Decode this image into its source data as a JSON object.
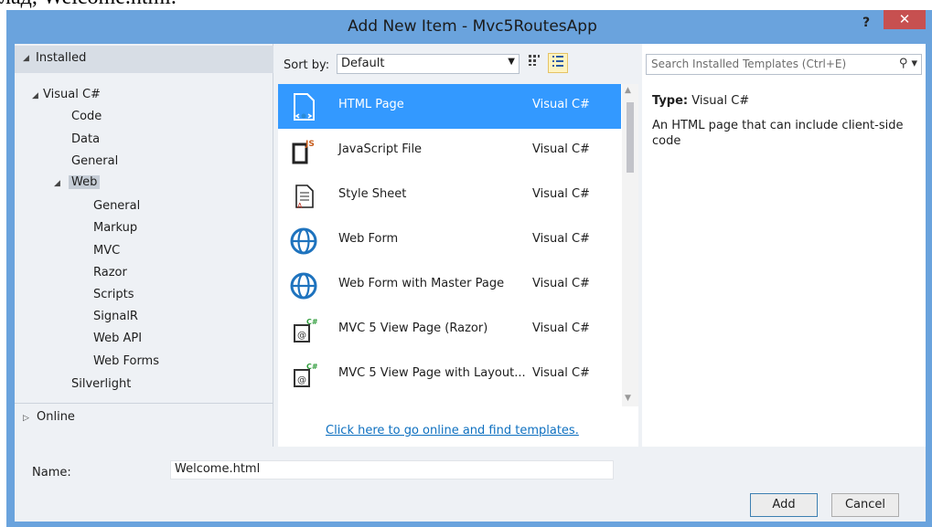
{
  "background_caption": "лад, Welcome.html.",
  "window": {
    "title": "Add New Item - Mvc5RoutesApp",
    "help": "?",
    "close": "✕"
  },
  "tree": {
    "installed": "Installed",
    "visual_csharp": "Visual C#",
    "code": "Code",
    "data": "Data",
    "general": "General",
    "web": "Web",
    "web_children": [
      "General",
      "Markup",
      "MVC",
      "Razor",
      "Scripts",
      "SignalR",
      "Web API",
      "Web Forms"
    ],
    "silverlight": "Silverlight",
    "online": "Online"
  },
  "sortbar": {
    "label": "Sort by:",
    "value": "Default"
  },
  "items": [
    {
      "name": "HTML Page",
      "type": "Visual C#",
      "icon": "html-page-icon",
      "selected": true
    },
    {
      "name": "JavaScript File",
      "type": "Visual C#",
      "icon": "javascript-file-icon",
      "selected": false
    },
    {
      "name": "Style Sheet",
      "type": "Visual C#",
      "icon": "style-sheet-icon",
      "selected": false
    },
    {
      "name": "Web Form",
      "type": "Visual C#",
      "icon": "web-form-icon",
      "selected": false
    },
    {
      "name": "Web Form with Master Page",
      "type": "Visual C#",
      "icon": "web-form-master-icon",
      "selected": false
    },
    {
      "name": "MVC 5 View Page (Razor)",
      "type": "Visual C#",
      "icon": "mvc-view-icon",
      "selected": false
    },
    {
      "name": "MVC 5 View Page with Layout...",
      "type": "Visual C#",
      "icon": "mvc-view-layout-icon",
      "selected": false
    }
  ],
  "online_link": "Click here to go online and find templates.",
  "search": {
    "placeholder": "Search Installed Templates (Ctrl+E)"
  },
  "details": {
    "type_label": "Type:",
    "type_value": "Visual C#",
    "description": "An HTML page that can include client-side code"
  },
  "name_field": {
    "label": "Name:",
    "value": "Welcome.html"
  },
  "buttons": {
    "add": "Add",
    "cancel": "Cancel"
  },
  "colors": {
    "titlebar": "#6aa3dd",
    "selection": "#3399ff",
    "close": "#c75050",
    "link": "#0e70c0"
  }
}
